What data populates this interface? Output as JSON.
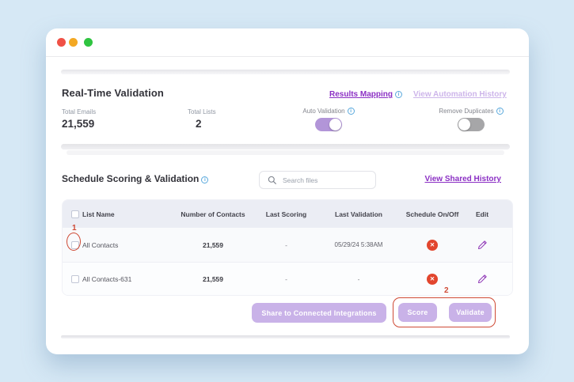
{
  "colors": {
    "background": "#d6e8f5",
    "accent_purple": "#8b2fc4",
    "disabled_link_purple": "#cdb5ea",
    "button_purple": "#c9b2e8",
    "toggle_on_purple": "#b295d8",
    "toggle_off_gray": "#a6a6a8",
    "status_red": "#e2462e",
    "annotation_red": "#cf4a35",
    "traffic_red": "#f05146",
    "traffic_yellow": "#f3a823",
    "traffic_green": "#2fc440"
  },
  "icons": {
    "info_glyph": "i",
    "close_glyph": "✕"
  },
  "realtime": {
    "title": "Real-Time Validation",
    "results_mapping_link": "Results Mapping",
    "view_automation_history_link": "View Automation History",
    "stats": [
      {
        "label": "Total Emails",
        "value": "21,559"
      },
      {
        "label": "Total Lists",
        "value": "2"
      }
    ],
    "auto_validation": {
      "label": "Auto Validation",
      "state": "on"
    },
    "remove_duplicates": {
      "label": "Remove Duplicates",
      "state": "off"
    }
  },
  "schedule": {
    "title": "Schedule Scoring & Validation",
    "search_placeholder": "Search files",
    "view_shared_history_link": "View Shared History",
    "table": {
      "headers": [
        "List Name",
        "Number of Contacts",
        "Last Scoring",
        "Last Validation",
        "Schedule On/Off",
        "Edit"
      ],
      "rows": [
        {
          "name": "All Contacts",
          "contacts": "21,559",
          "last_scoring": "-",
          "last_validation": "05/29/24 5:38AM",
          "schedule_state": "off"
        },
        {
          "name": "All Contacts-631",
          "contacts": "21,559",
          "last_scoring": "-",
          "last_validation": "-",
          "schedule_state": "off"
        }
      ]
    },
    "buttons": {
      "share": "Share to Connected Integrations",
      "score": "Score",
      "validate": "Validate"
    }
  },
  "annotations": {
    "step1": "1",
    "step2": "2"
  }
}
